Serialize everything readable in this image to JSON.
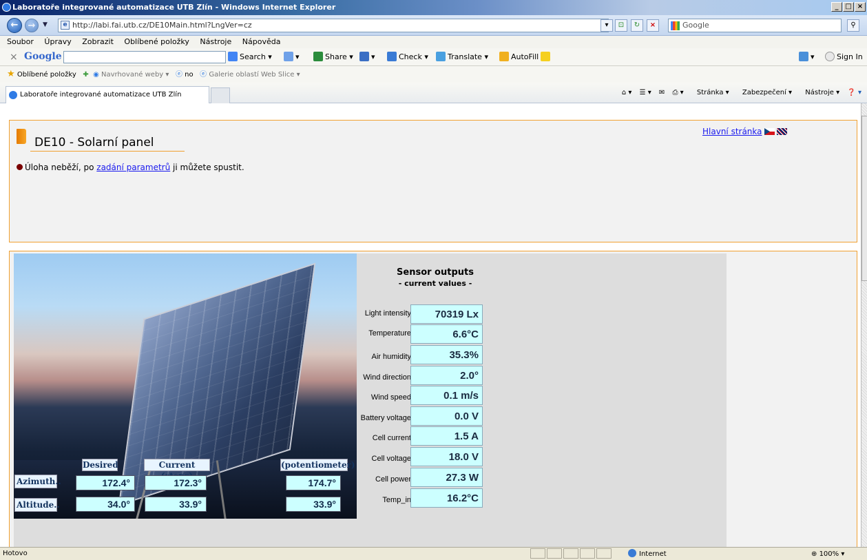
{
  "window": {
    "title": "Laboratoře integrované automatizace UTB Zlín - Windows Internet Explorer"
  },
  "address": {
    "url": "http://labi.fai.utb.cz/DE10Main.html?LngVer=cz",
    "search_placeholder": "Google"
  },
  "menu": [
    "Soubor",
    "Úpravy",
    "Zobrazit",
    "Oblíbené položky",
    "Nástroje",
    "Nápověda"
  ],
  "googlebar": {
    "logo": "Google",
    "search_label": "Search",
    "share_label": "Share",
    "check_label": "Check",
    "translate_label": "Translate",
    "autofill_label": "AutoFill",
    "signin_label": "Sign In"
  },
  "favorites": {
    "fav_label": "Oblíbené položky",
    "suggested": "Navrhované weby",
    "no": "no",
    "gallery": "Galerie oblastí Web Slice"
  },
  "tab": {
    "label": "Laboratoře integrované automatizace UTB Zlín"
  },
  "commands": {
    "page": "Stránka",
    "security": "Zabezpečení",
    "tools": "Nástroje"
  },
  "page": {
    "title": "DE10 - Solarní panel",
    "status_pre": "Úloha neběží, po ",
    "status_link": "zadání parametrů",
    "status_post": " ji můžete spustit.",
    "main_link": "Hlavní stránka"
  },
  "control": {
    "headers": {
      "desired": "Desired",
      "current": "Current (steps)",
      "pot": "(potentiometer)"
    },
    "azimuth": {
      "label": "Azimuth..",
      "desired": "172.4°",
      "current": "172.3°",
      "pot": "174.7°"
    },
    "altitude": {
      "label": "Altitude..",
      "desired": "34.0°",
      "current": "33.9°",
      "pot": "33.9°"
    }
  },
  "sensors": {
    "title": "Sensor outputs",
    "subtitle": "- current values -",
    "rows": [
      {
        "label": "Light intensity",
        "value": "70319 Lx"
      },
      {
        "label": "Temperature",
        "value": "6.6°C"
      },
      {
        "label": "Air humidity",
        "value": "35.3%"
      },
      {
        "label": "Wind direction",
        "value": "2.0°"
      },
      {
        "label": "Wind speed",
        "value": "0.1 m/s"
      },
      {
        "label": "Battery voltage",
        "value": "0.0 V"
      },
      {
        "label": "Cell current",
        "value": "1.5 A"
      },
      {
        "label": "Cell voltage",
        "value": "18.0 V"
      },
      {
        "label": "Cell power",
        "value": "27.3 W"
      },
      {
        "label": "Temp_in",
        "value": "16.2°C"
      }
    ]
  },
  "statusbar": {
    "text": "Hotovo",
    "zone": "Internet",
    "zoom": "100%"
  }
}
